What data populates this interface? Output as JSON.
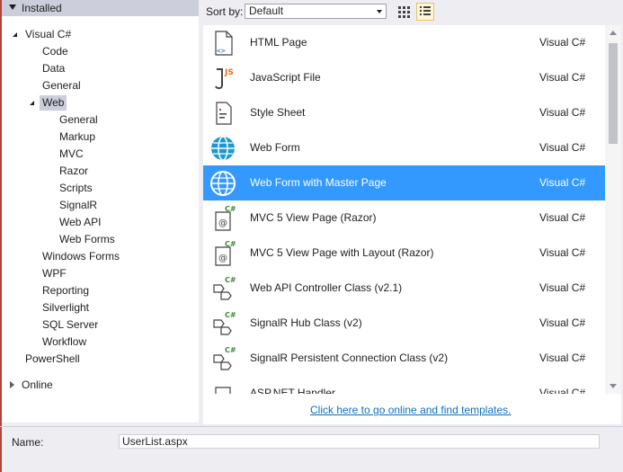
{
  "tree": {
    "installed_label": "Installed",
    "visual_csharp": "Visual C#",
    "code": "Code",
    "data": "Data",
    "general": "General",
    "web": "Web",
    "web_children": [
      "General",
      "Markup",
      "MVC",
      "Razor",
      "Scripts",
      "SignalR",
      "Web API",
      "Web Forms"
    ],
    "windows_forms": "Windows Forms",
    "wpf": "WPF",
    "reporting": "Reporting",
    "silverlight": "Silverlight",
    "sql_server": "SQL Server",
    "workflow": "Workflow",
    "powershell": "PowerShell",
    "online_label": "Online"
  },
  "sort": {
    "label": "Sort by:",
    "value": "Default"
  },
  "templates": [
    {
      "name": "HTML Page",
      "lang": "Visual C#",
      "icon": "html-page-icon"
    },
    {
      "name": "JavaScript File",
      "lang": "Visual C#",
      "icon": "javascript-file-icon"
    },
    {
      "name": "Style Sheet",
      "lang": "Visual C#",
      "icon": "style-sheet-icon"
    },
    {
      "name": "Web Form",
      "lang": "Visual C#",
      "icon": "globe-icon"
    },
    {
      "name": "Web Form with Master Page",
      "lang": "Visual C#",
      "icon": "globe-icon",
      "selected": true
    },
    {
      "name": "MVC 5 View Page (Razor)",
      "lang": "Visual C#",
      "icon": "razor-view-icon"
    },
    {
      "name": "MVC 5 View Page with Layout (Razor)",
      "lang": "Visual C#",
      "icon": "razor-view-icon"
    },
    {
      "name": "Web API Controller Class (v2.1)",
      "lang": "Visual C#",
      "icon": "csharp-class-icon"
    },
    {
      "name": "SignalR Hub Class (v2)",
      "lang": "Visual C#",
      "icon": "csharp-class-icon"
    },
    {
      "name": "SignalR Persistent Connection Class (v2)",
      "lang": "Visual C#",
      "icon": "csharp-class-icon"
    },
    {
      "name": "ASP.NET Handler",
      "lang": "Visual C#",
      "icon": "handler-icon"
    }
  ],
  "online_link": "Click here to go online and find templates.",
  "name_field": {
    "label": "Name:",
    "value": "UserList.aspx"
  },
  "colors": {
    "selection": "#3399ff",
    "link": "#0e70c0",
    "header": "#cccedb"
  }
}
